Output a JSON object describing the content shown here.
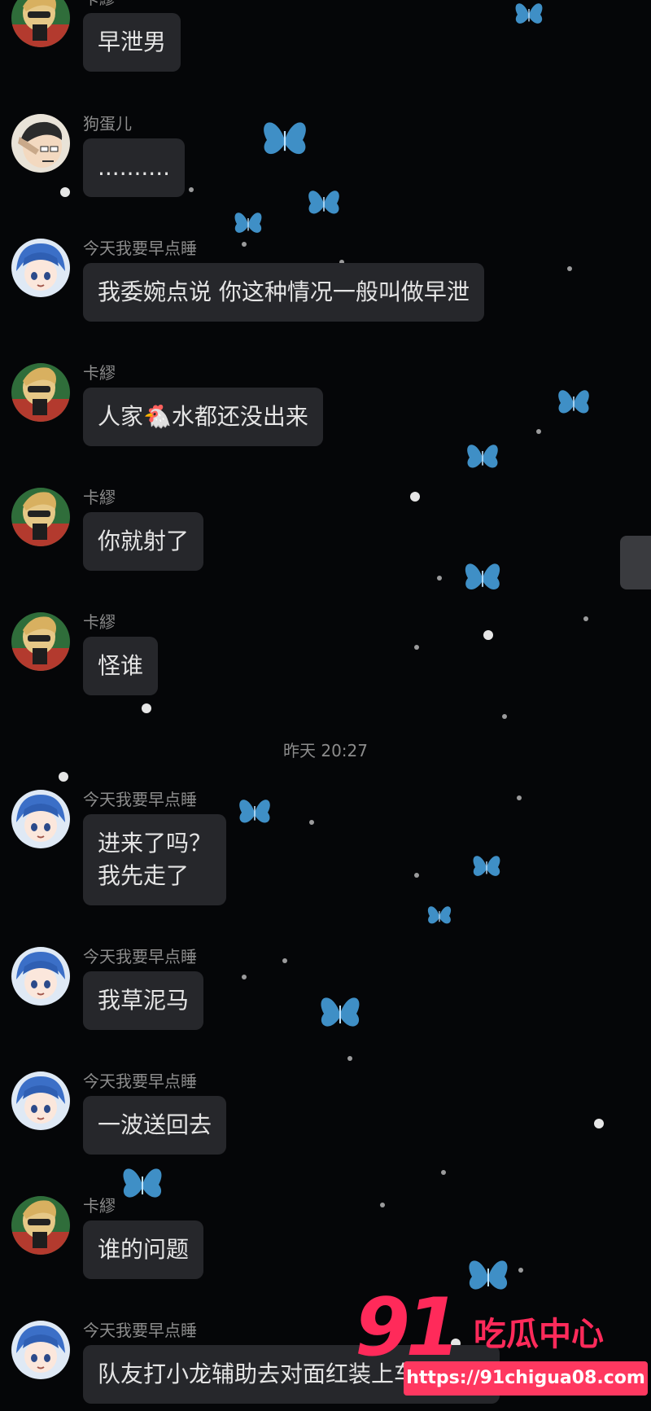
{
  "messages": [
    {
      "sender": "卡繆",
      "avatar": "avatar-kamiu",
      "text": "早泄男"
    },
    {
      "sender": "狗蛋儿",
      "avatar": "avatar-goudan",
      "text": ".........."
    },
    {
      "sender": "今天我要早点睡",
      "avatar": "avatar-blue",
      "text": "我委婉点说 你这种情况一般叫做早泄"
    },
    {
      "sender": "卡繆",
      "avatar": "avatar-kamiu",
      "text": "人家🐔水都还没出来"
    },
    {
      "sender": "卡繆",
      "avatar": "avatar-kamiu",
      "text": "你就射了"
    },
    {
      "sender": "卡繆",
      "avatar": "avatar-kamiu",
      "text": "怪谁"
    },
    {
      "sender": "今天我要早点睡",
      "avatar": "avatar-blue",
      "text": "进来了吗？\n我先走了"
    },
    {
      "sender": "今天我要早点睡",
      "avatar": "avatar-blue",
      "text": "我草泥马"
    },
    {
      "sender": "今天我要早点睡",
      "avatar": "avatar-blue",
      "text": "一波送回去"
    },
    {
      "sender": "卡繆",
      "avatar": "avatar-kamiu",
      "text": "谁的问题"
    },
    {
      "sender": "今天我要早点睡",
      "avatar": "avatar-blue",
      "text": "队友打小龙辅助去对面红装上车的问题"
    }
  ],
  "timestamp": "昨天 20:27",
  "watermark": {
    "number": "91",
    "text": "吃瓜中心",
    "url": "https://91chigua08.com",
    "color": "#ff2a5a"
  },
  "colors": {
    "background": "#050608",
    "bubble": "#26272b",
    "bubble_text": "#e4e4e4",
    "meta_text": "#8c8c8c",
    "butterfly": "#4aa8e8"
  }
}
